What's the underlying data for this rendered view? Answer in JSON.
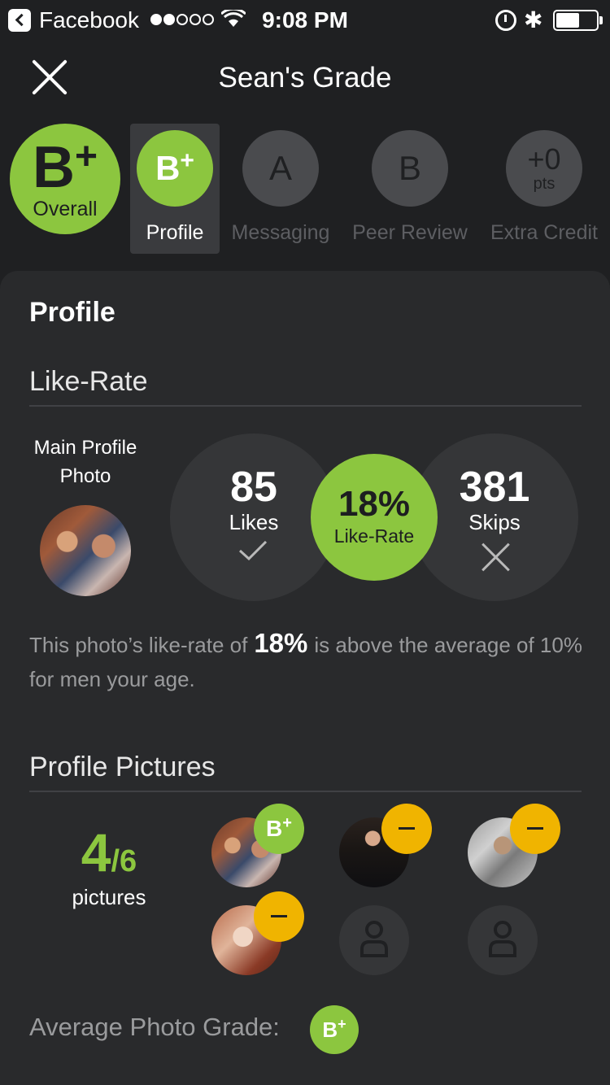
{
  "status_bar": {
    "back_app": "Facebook",
    "time": "9:08 PM",
    "bluetooth": "✱"
  },
  "header": {
    "title": "Sean's Grade"
  },
  "overall": {
    "grade_letter": "B",
    "grade_mod": "+",
    "label": "Overall"
  },
  "tabs": [
    {
      "letter": "B",
      "mod": "+",
      "label": "Profile",
      "active": true
    },
    {
      "letter": "A",
      "mod": "",
      "label": "Messaging",
      "active": false
    },
    {
      "letter": "B",
      "mod": "",
      "label": "Peer Review",
      "active": false
    },
    {
      "pts_value": "+0",
      "pts_unit": "pts",
      "label": "Extra Credit",
      "active": false
    }
  ],
  "profile": {
    "heading": "Profile",
    "like_rate": {
      "heading": "Like-Rate",
      "main_photo_label": "Main Profile Photo",
      "likes_value": "85",
      "likes_label": "Likes",
      "rate_value": "18%",
      "rate_label": "Like-Rate",
      "skips_value": "381",
      "skips_label": "Skips",
      "desc_before": "This photo’s like-rate of",
      "desc_highlight": "18%",
      "desc_after": "is above the average of 10% for men your age."
    },
    "pictures": {
      "heading": "Profile Pictures",
      "count_num": "4",
      "count_den": "/6",
      "count_label": "pictures",
      "photo1_grade": "B",
      "photo1_mod": "+",
      "avg_label": "Average Photo Grade:",
      "avg_grade": "B",
      "avg_mod": "+"
    }
  },
  "colors": {
    "background": "#1f2022",
    "panel": "#292a2c",
    "accent_green": "#8cc63f",
    "warn_yellow": "#f0b400",
    "muted_text": "#9a9b9d"
  }
}
